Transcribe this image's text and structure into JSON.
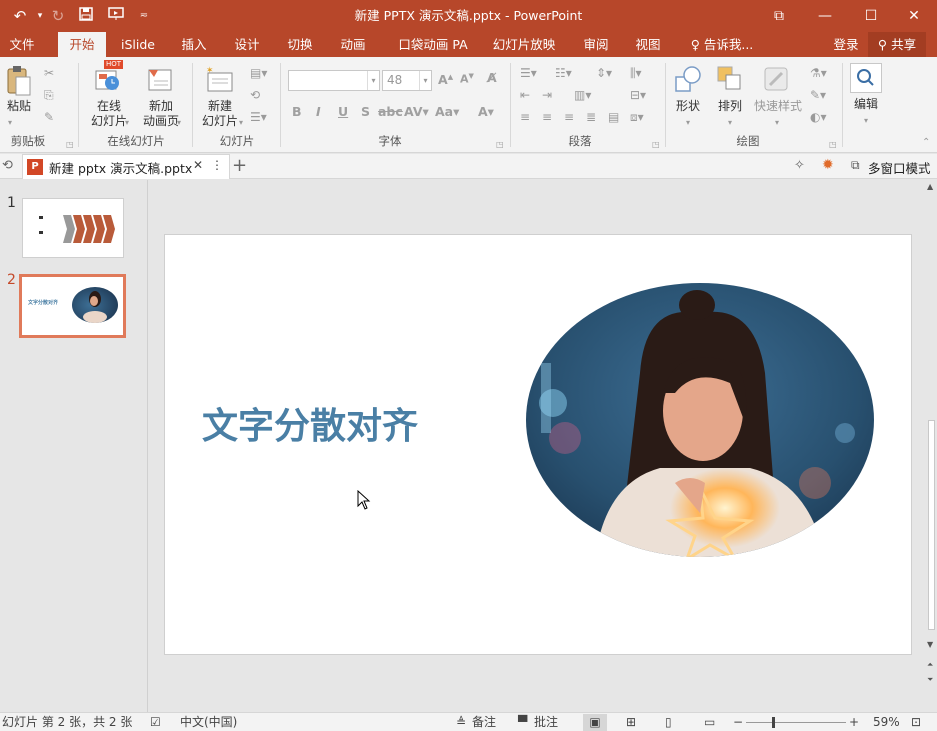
{
  "window": {
    "title": "新建 PPTX 演示文稿.pptx - PowerPoint"
  },
  "menu": {
    "tabs": [
      {
        "label": "文件"
      },
      {
        "label": "开始"
      },
      {
        "label": "iSlide"
      },
      {
        "label": "插入"
      },
      {
        "label": "设计"
      },
      {
        "label": "切换"
      },
      {
        "label": "动画"
      },
      {
        "label": "口袋动画 PA"
      },
      {
        "label": "幻灯片放映"
      },
      {
        "label": "审阅"
      },
      {
        "label": "视图"
      }
    ],
    "active_tab": "开始",
    "tell_me": "告诉我...",
    "sign_in": "登录",
    "share": "共享"
  },
  "ribbon": {
    "clipboard": {
      "paste": "粘贴",
      "group": "剪贴板"
    },
    "online_slides": {
      "online_slide": "在线\n幻灯片",
      "new_anim": "新加\n动画页",
      "hot_badge": "HOT",
      "group": "在线幻灯片"
    },
    "slides": {
      "new_slide": "新建\n幻灯片",
      "group": "幻灯片"
    },
    "font": {
      "font_name": "",
      "font_size": "48",
      "group": "字体"
    },
    "paragraph": {
      "group": "段落"
    },
    "drawing": {
      "shape": "形状",
      "arrange": "排列",
      "quick_styles": "快速样式",
      "group": "绘图"
    },
    "editing": {
      "edit": "编辑"
    }
  },
  "doc_tab": {
    "name": "新建 pptx 演示文稿.pptx",
    "multi_window": "多窗口模式"
  },
  "thumbnails": [
    {
      "number": "1"
    },
    {
      "number": "2",
      "caption": "文字分散对齐"
    }
  ],
  "slide": {
    "title_text": "文字分散对齐",
    "title_color": "#4a7fa5"
  },
  "status": {
    "slide_info": "幻灯片 第 2 张，共 2 张",
    "language": "中文(中国)",
    "notes": "备注",
    "comments": "批注",
    "zoom": "59%"
  },
  "colors": {
    "accent": "#b7472a",
    "slide_title": "#4a7fa5"
  }
}
